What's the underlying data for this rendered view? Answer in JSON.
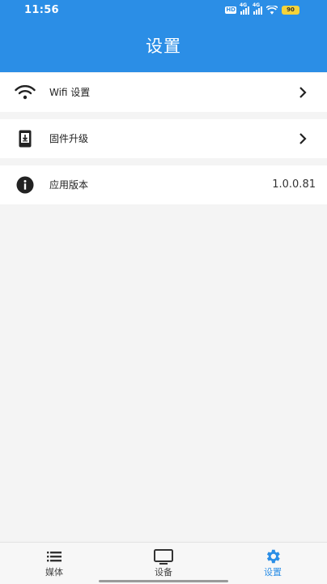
{
  "status_bar": {
    "time": "11:56",
    "hd_badge": "HD",
    "network_1": "4G",
    "network_2": "4G",
    "battery": "90"
  },
  "header": {
    "title": "设置"
  },
  "settings": {
    "items": [
      {
        "label": "Wifi 设置",
        "icon": "wifi-icon",
        "trailing": "chevron-right-icon"
      },
      {
        "label": "固件升级",
        "icon": "firmware-download-icon",
        "trailing": "chevron-right-icon"
      },
      {
        "label": "应用版本",
        "icon": "info-icon",
        "value": "1.0.0.81"
      }
    ]
  },
  "bottom_nav": {
    "items": [
      {
        "label": "媒体",
        "icon": "list-icon",
        "active": false
      },
      {
        "label": "设备",
        "icon": "monitor-icon",
        "active": false
      },
      {
        "label": "设置",
        "icon": "gear-icon",
        "active": true
      }
    ]
  },
  "colors": {
    "primary": "#2b8ee6",
    "background": "#f4f4f4",
    "row_background": "#ffffff",
    "text": "#222222",
    "battery": "#f5d33a"
  }
}
